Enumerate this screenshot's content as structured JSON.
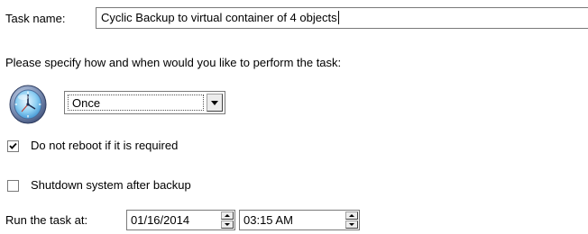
{
  "task": {
    "name_label": "Task name:",
    "name_value": "Cyclic Backup to virtual container of 4 objects"
  },
  "instruction": "Please specify how and when would you like to perform the task:",
  "schedule": {
    "icon": "clock-icon",
    "selected": "Once"
  },
  "options": {
    "no_reboot": {
      "label": "Do not reboot if it is required",
      "checked": true
    },
    "shutdown": {
      "label": "Shutdown system after backup",
      "checked": false
    }
  },
  "run": {
    "label": "Run the task at:",
    "date": "01/16/2014",
    "time": "03:15 AM"
  }
}
